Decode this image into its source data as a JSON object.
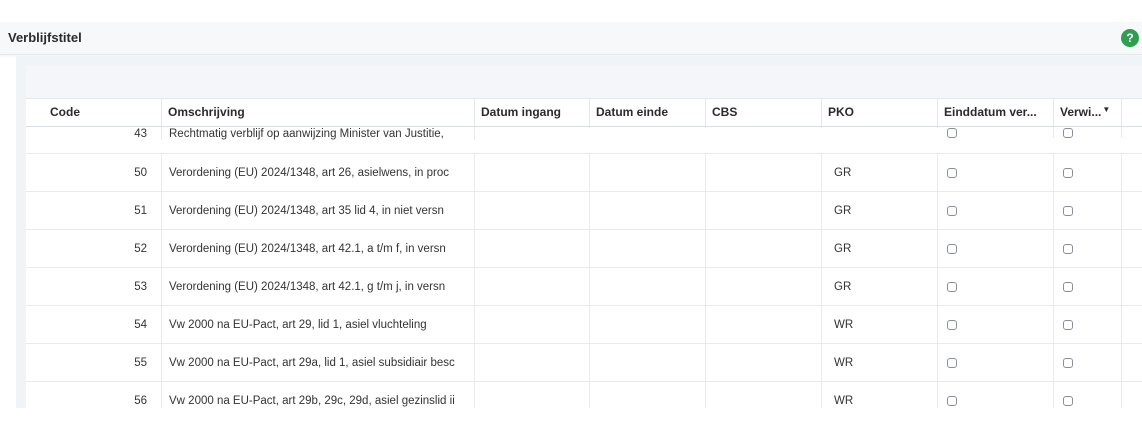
{
  "window": {
    "title": "Verblijfstitel",
    "help_icon": "?",
    "accent_color": "#2e9e4f"
  },
  "table": {
    "columns": [
      {
        "key": "code",
        "label": "Code"
      },
      {
        "key": "omschrijving",
        "label": "Omschrijving"
      },
      {
        "key": "ingang",
        "label": "Datum ingang"
      },
      {
        "key": "einde",
        "label": "Datum einde"
      },
      {
        "key": "cbs",
        "label": "CBS"
      },
      {
        "key": "pko",
        "label": "PKO"
      },
      {
        "key": "einddatum",
        "label": "Einddatum ver..."
      },
      {
        "key": "verwi",
        "label": "Verwi...",
        "sort_indicator": "▼"
      }
    ],
    "rows": [
      {
        "code": "43",
        "omschrijving": "Rechtmatig verblijf op aanwijzing Minister van Justitie,",
        "ingang": "",
        "einde": "",
        "cbs": "",
        "pko": "",
        "einddatum_checked": false,
        "verwi_checked": false
      },
      {
        "code": "50",
        "omschrijving": "Verordening (EU) 2024/1348, art 26, asielwens, in proc",
        "ingang": "",
        "einde": "",
        "cbs": "",
        "pko": "GR",
        "einddatum_checked": false,
        "verwi_checked": false
      },
      {
        "code": "51",
        "omschrijving": "Verordening (EU) 2024/1348, art 35 lid 4, in niet versn",
        "ingang": "",
        "einde": "",
        "cbs": "",
        "pko": "GR",
        "einddatum_checked": false,
        "verwi_checked": false
      },
      {
        "code": "52",
        "omschrijving": "Verordening (EU) 2024/1348, art 42.1, a t/m f, in versn",
        "ingang": "",
        "einde": "",
        "cbs": "",
        "pko": "GR",
        "einddatum_checked": false,
        "verwi_checked": false
      },
      {
        "code": "53",
        "omschrijving": "Verordening (EU) 2024/1348, art 42.1, g t/m j, in versn",
        "ingang": "",
        "einde": "",
        "cbs": "",
        "pko": "GR",
        "einddatum_checked": false,
        "verwi_checked": false
      },
      {
        "code": "54",
        "omschrijving": "Vw 2000 na EU-Pact, art 29, lid 1, asiel vluchteling",
        "ingang": "",
        "einde": "",
        "cbs": "",
        "pko": "WR",
        "einddatum_checked": false,
        "verwi_checked": false
      },
      {
        "code": "55",
        "omschrijving": "Vw 2000 na EU-Pact, art 29a, lid 1, asiel subsidiair besc",
        "ingang": "",
        "einde": "",
        "cbs": "",
        "pko": "WR",
        "einddatum_checked": false,
        "verwi_checked": false
      },
      {
        "code": "56",
        "omschrijving": "Vw 2000 na EU-Pact, art 29b, 29c, 29d, asiel gezinslid ii",
        "ingang": "",
        "einde": "",
        "cbs": "",
        "pko": "WR",
        "einddatum_checked": false,
        "verwi_checked": false
      }
    ]
  }
}
